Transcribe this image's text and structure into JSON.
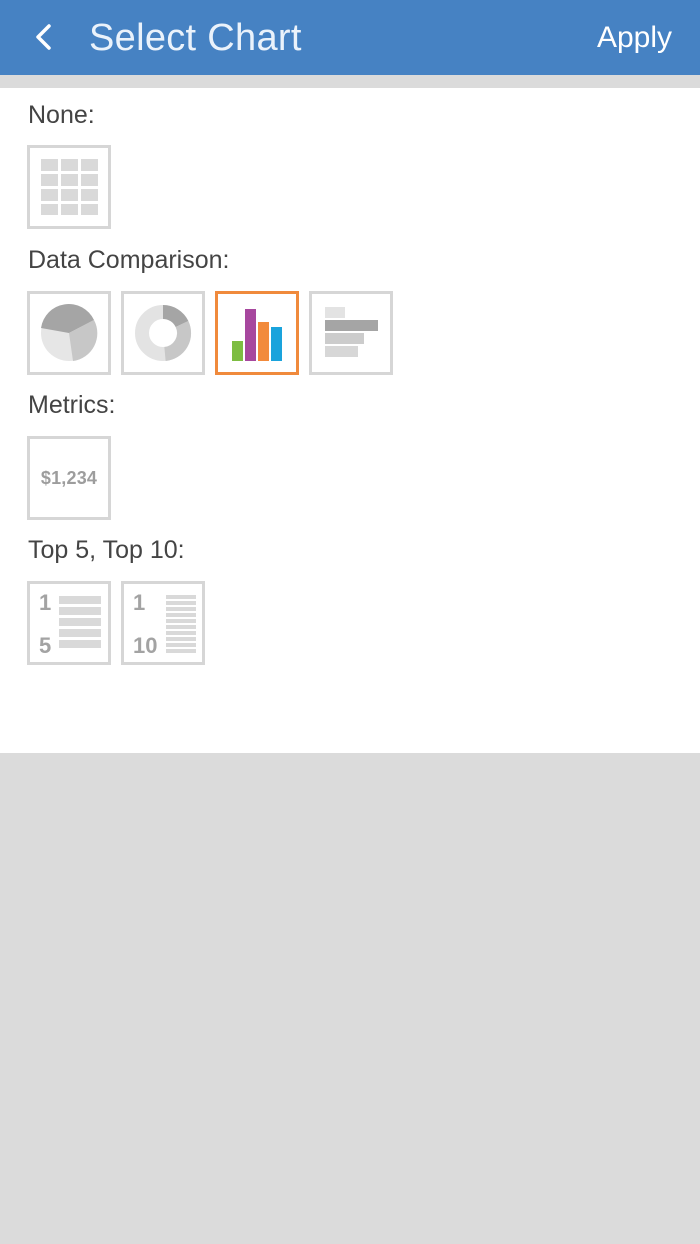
{
  "header": {
    "back_icon": "chevron-left-icon",
    "title": "Select Chart",
    "apply_label": "Apply"
  },
  "sections": {
    "none": {
      "label": "None:",
      "items": [
        {
          "icon": "table-grid-icon",
          "selected": false
        }
      ]
    },
    "data_comparison": {
      "label": "Data Comparison:",
      "items": [
        {
          "icon": "pie-chart-icon",
          "selected": false
        },
        {
          "icon": "donut-chart-icon",
          "selected": false
        },
        {
          "icon": "bar-chart-icon",
          "selected": true
        },
        {
          "icon": "horizontal-bar-chart-icon",
          "selected": false
        }
      ]
    },
    "metrics": {
      "label": "Metrics:",
      "items": [
        {
          "icon": "metric-value-icon",
          "text": "$1,234",
          "selected": false
        }
      ]
    },
    "top": {
      "label": "Top 5, Top 10:",
      "items": [
        {
          "icon": "top-5-list-icon",
          "first": "1",
          "last": "5",
          "selected": false
        },
        {
          "icon": "top-10-list-icon",
          "first": "1",
          "last": "10",
          "selected": false
        }
      ]
    }
  },
  "colors": {
    "header_bg": "#4682c3",
    "selected_border": "#f08a3c",
    "tile_border": "#d6d6d6",
    "bar_green": "#7dbd42",
    "bar_purple": "#a7479e",
    "bar_orange": "#f28a3b",
    "bar_blue": "#1aa3dc"
  }
}
